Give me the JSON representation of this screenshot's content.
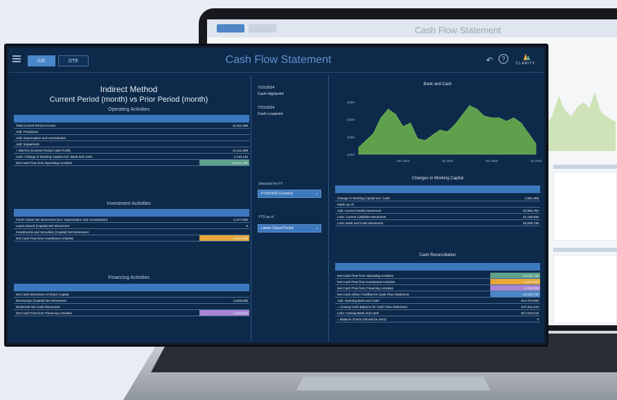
{
  "app": {
    "title": "Cash Flow Statement",
    "tabs": [
      "IDE",
      "DTE"
    ],
    "logo_text": "CLARITY"
  },
  "left": {
    "heading": "Indirect Method",
    "subheading": "Current Period (month) vs Prior Period (month)",
    "operating": {
      "title": "Operating Activities",
      "rows": [
        {
          "label": "Total Current Period Income",
          "value": "11,411,085"
        },
        {
          "label": "Add: Provisions",
          "value": ""
        },
        {
          "label": "Add: Depreciation and Amortisation",
          "value": ""
        },
        {
          "label": "Add: Impairment",
          "value": ""
        },
        {
          "label": "+ EBITDA (Current Period Cash Profit)",
          "value": "11,411,085"
        },
        {
          "label": "Less: Change in Working Capital excl. Bank and Cash",
          "value": "1,140,146"
        },
        {
          "label": "Net Cash Flow from Operating Activities",
          "value": "13,151,725"
        }
      ]
    },
    "investment": {
      "title": "Investment Activities",
      "rows": [
        {
          "label": "Fixed Assets Net Movement (incl. Depreciation and Amortisation)",
          "value": "-1,677,936"
        },
        {
          "label": "Loans Issued (Capital) Net Movement",
          "value": "0"
        },
        {
          "label": "Investments and Securities (Capital) Net Movement",
          "value": ""
        },
        {
          "label": "Net Cash Flow from Investment Activities",
          "value": "-1,677,936"
        }
      ]
    },
    "financing": {
      "title": "Financing Activities",
      "rows": [
        {
          "label": "Net Cash Movement of Share Capital",
          "value": ""
        },
        {
          "label": "Borrowings (Capital) Net Movement",
          "value": "-4,828,838"
        },
        {
          "label": "Dividends Net Cash Movement",
          "value": ""
        },
        {
          "label": "Net Cash Flow from Financing Activities",
          "value": "-4,828,838"
        }
      ]
    }
  },
  "middle": {
    "date1": "7/31/2024",
    "date1_label": "Cash Highpoint",
    "date2": "7/31/2024",
    "date2_label": "Cash Lowpoint",
    "slicer1_label": "Selected Fin YY",
    "slicer1_value": "FY2024/25 (Current)",
    "slicer2_label": "YTD as of",
    "slicer2_value": "Latest Closed Period"
  },
  "right": {
    "chart_title": "Bank and Cash",
    "wc_title": "Changes in Working Capital",
    "wc_rows": [
      {
        "label": "Change in Working Capital incl. Cash",
        "value": "1,801,365"
      },
      {
        "label": "Made up of:",
        "value": ""
      },
      {
        "label": "Add: Current Assets Movement",
        "value": "32,963,752"
      },
      {
        "label": "Less: Current Liabilities Movement",
        "value": "31,106,836"
      },
      {
        "label": "Less: Bank and Cash Movement",
        "value": "32,609,738"
      }
    ],
    "recon_title": "Cash Reconciliation",
    "recon_rows": [
      {
        "label": "Net Cash Flow from Operating Activities",
        "value": "13,151,725",
        "color": "#5fa08a"
      },
      {
        "label": "Net Cash Flow from Investment Activities",
        "value": "-1,677,936",
        "color": "#e6a83a"
      },
      {
        "label": "Net Cash Flow from Financing Activities",
        "value": "-4,828,838",
        "color": "#a785d6"
      },
      {
        "label": "Net Cash Inflow / Outflow for Cash Flow Statement",
        "value": "32,609,738",
        "color": "#4b88c9"
      },
      {
        "label": "Add: Opening Bank and Cash",
        "value": "614,374,948",
        "color": ""
      },
      {
        "label": "= Closing Cash Balance for Cash Flow Statement",
        "value": "647,011,519",
        "color": ""
      },
      {
        "label": "Less: Closing Bank and Cash",
        "value": "627,016,519",
        "color": ""
      },
      {
        "label": "= Balance Check (Should be Zero)",
        "value": "0",
        "color": ""
      }
    ]
  },
  "chart_data": {
    "type": "area",
    "title": "Bank and Cash",
    "xlabel": "",
    "ylabel": "",
    "x": [
      "Jul 2023",
      "Aug 2023",
      "Sep 2023",
      "Oct 2023",
      "Nov 2023",
      "Dec 2023",
      "Jan 2024",
      "Feb 2024",
      "Mar 2024",
      "Apr 2024",
      "May 2024",
      "Jun 2024",
      "Jul 2024",
      "Aug 2024",
      "Sep 2024",
      "Oct 2024",
      "Nov 2024",
      "Dec 2024",
      "Jan 2025",
      "Feb 2025",
      "Mar 2025",
      "Apr 2025",
      "May 2025",
      "Jun 2025",
      "Jul 2025"
    ],
    "y_ticks": [
      "220M",
      "240M",
      "260M",
      "280M"
    ],
    "x_ticks": [
      "Jan 2024",
      "Jul 2024",
      "Jan 2025",
      "Jul 2025"
    ],
    "ylim": [
      220,
      290
    ],
    "values": [
      228,
      236,
      244,
      262,
      272,
      266,
      252,
      256,
      238,
      236,
      242,
      248,
      246,
      254,
      265,
      276,
      272,
      264,
      262,
      262,
      258,
      262,
      256,
      244,
      232
    ],
    "color": "#5fa04c"
  }
}
